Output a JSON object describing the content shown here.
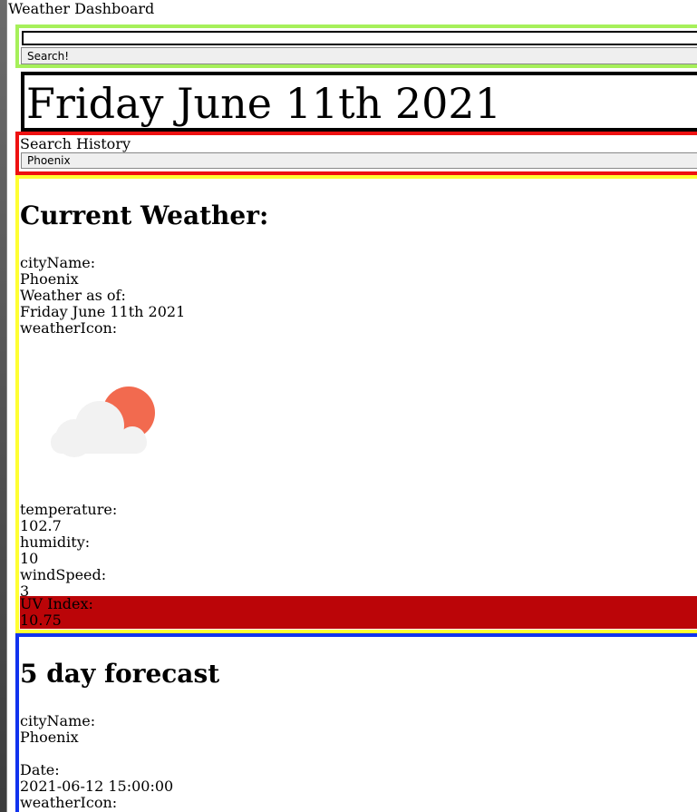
{
  "app": {
    "title": "Weather Dashboard"
  },
  "search": {
    "input_value": "",
    "button_label": "Search!"
  },
  "date_banner": {
    "text": "Friday June 11th 2021"
  },
  "history": {
    "label": "Search History",
    "items": [
      "Phoenix"
    ]
  },
  "current": {
    "heading": "Current Weather:",
    "city_label": "cityName:",
    "city_value": "Phoenix",
    "asof_label": "Weather as of:",
    "asof_value": "Friday June 11th 2021",
    "icon_label": "weatherIcon:",
    "icon": "cloud-sun-icon",
    "temp_label": "temperature:",
    "temp_value": "102.7",
    "humidity_label": "humidity:",
    "humidity_value": "10",
    "wind_label": "windSpeed:",
    "wind_value": "3",
    "uv_label": "UV Index:",
    "uv_value": "10.75"
  },
  "forecast": {
    "heading": "5 day forecast",
    "city_label": "cityName:",
    "city_value": "Phoenix",
    "date_label": "Date:",
    "date_value": "2021-06-12 15:00:00",
    "icon_label": "weatherIcon:"
  },
  "colors": {
    "search_border": "#a6f05a",
    "date_border": "#000000",
    "history_border": "#ee1111",
    "current_border": "#ffff33",
    "uv_background": "#bb0508",
    "forecast_border": "#1133ee",
    "sun": "#f26a4f",
    "cloud": "#f2f2f2"
  }
}
